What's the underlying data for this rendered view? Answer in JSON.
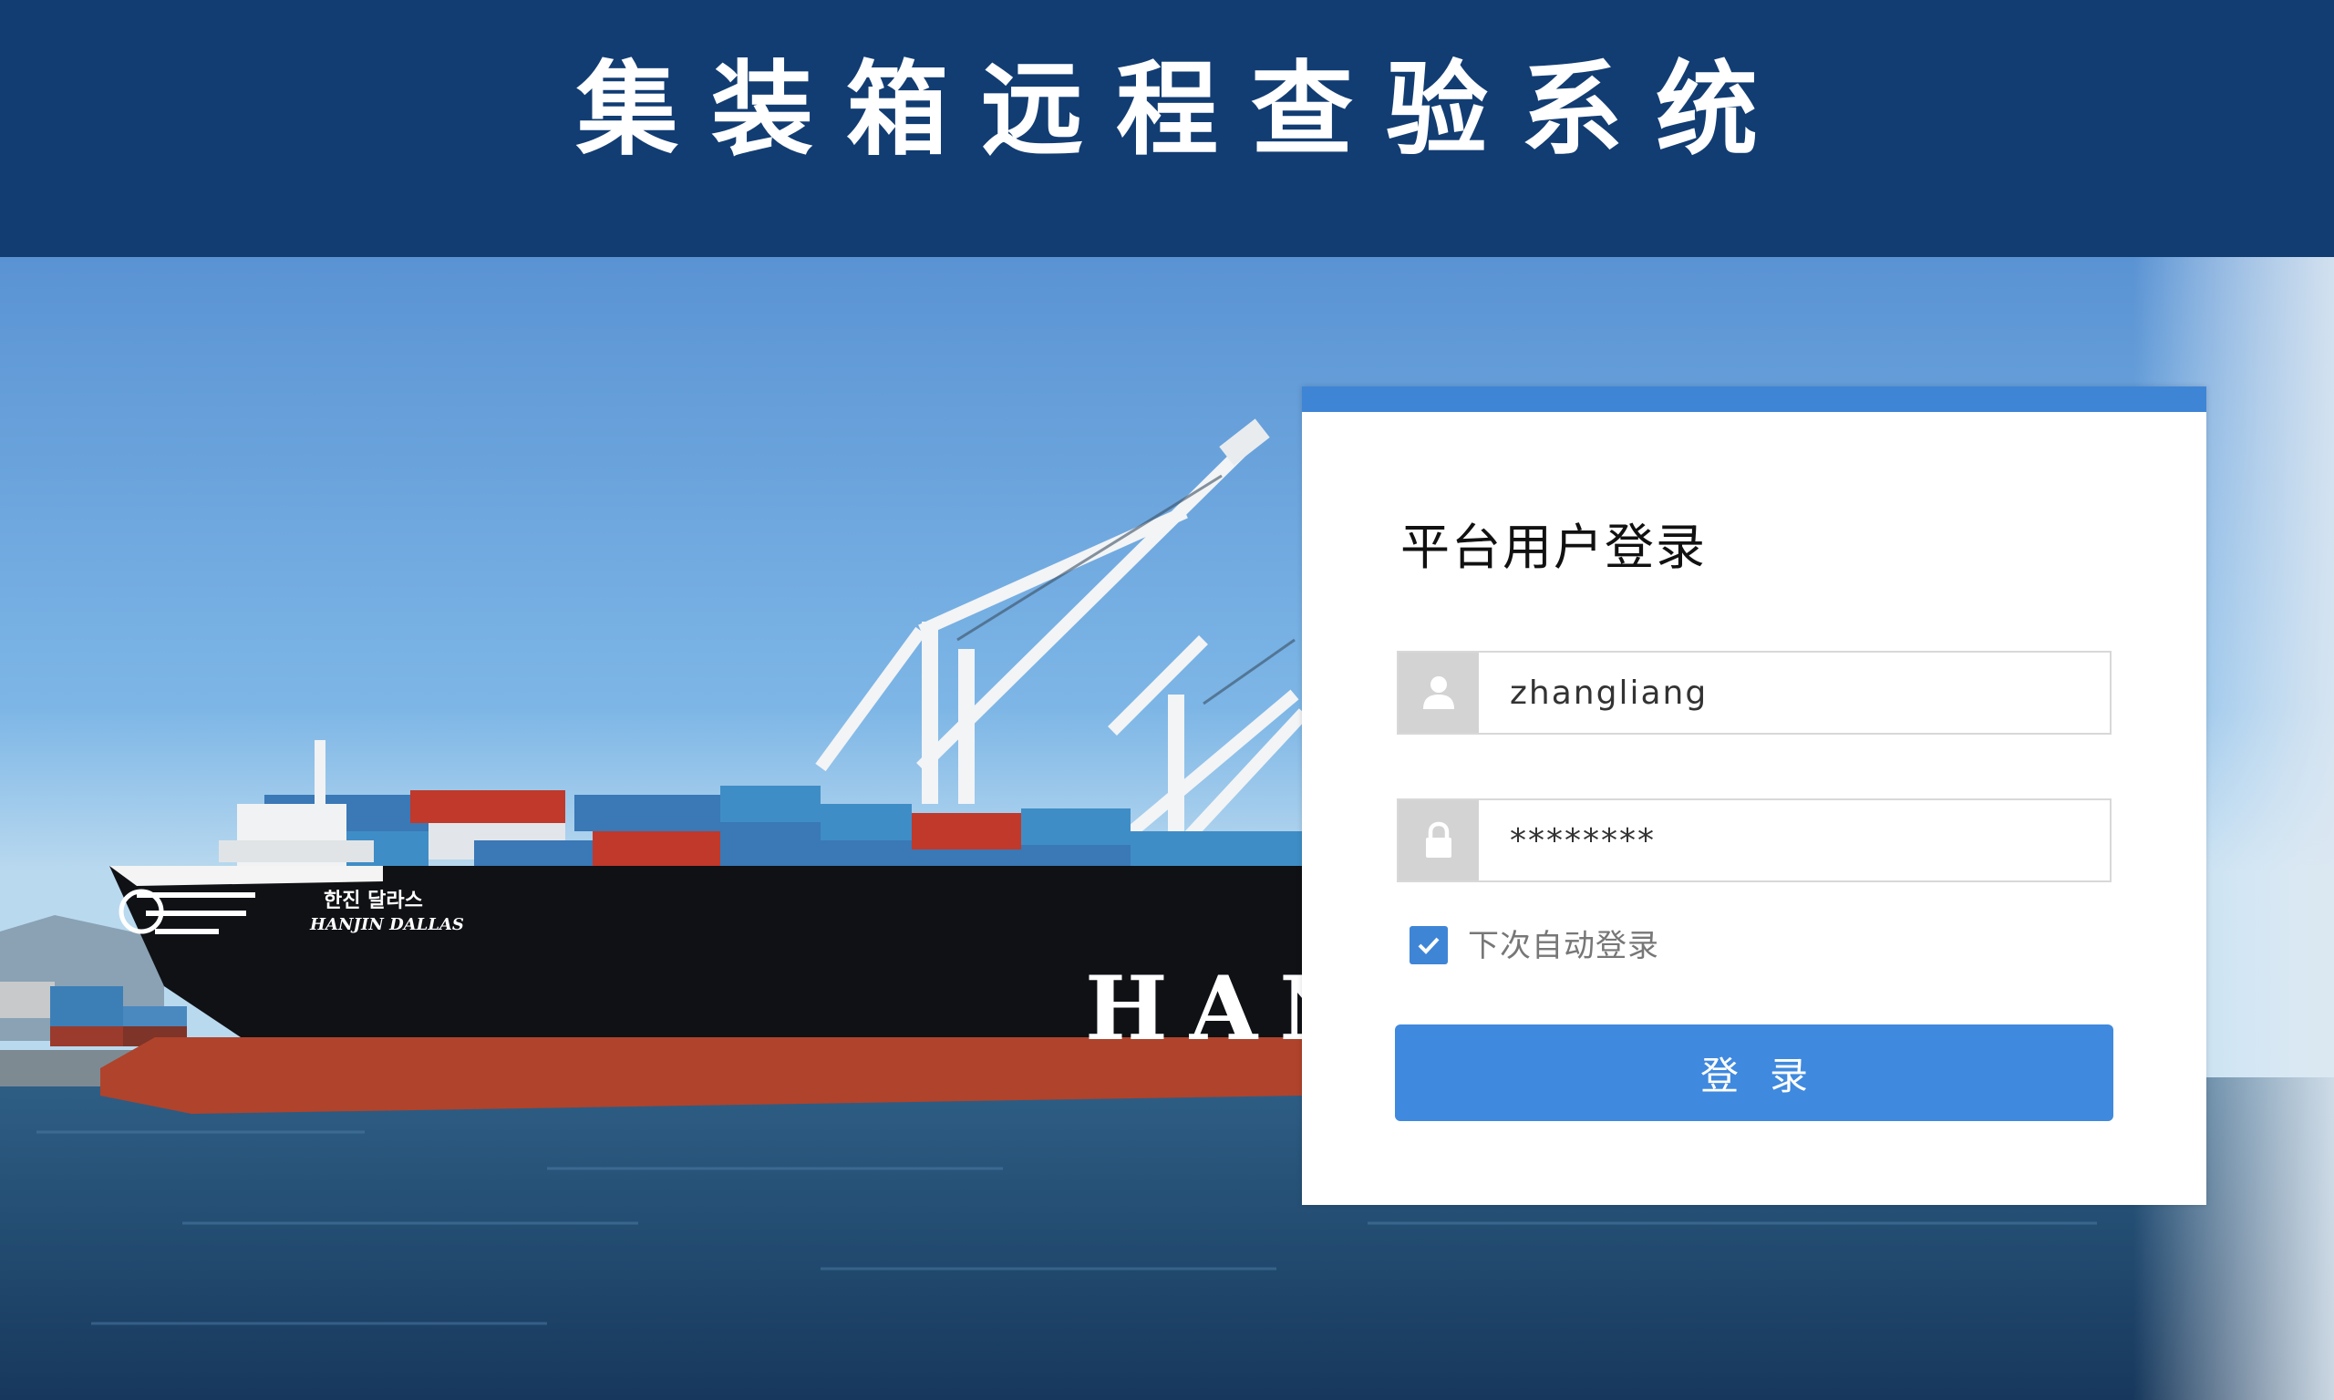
{
  "header": {
    "title": "集装箱远程查验系统"
  },
  "scene": {
    "ship_name_korean": "한진 달라스",
    "ship_name": "HANJIN DALLAS",
    "hull_lettering": "HAN"
  },
  "login": {
    "title": "平台用户登录",
    "username": {
      "icon": "user-icon",
      "value": "zhangliang"
    },
    "password": {
      "icon": "lock-icon",
      "value": "********"
    },
    "remember": {
      "label": "下次自动登录",
      "checked": true
    },
    "submit_label": "登录"
  },
  "colors": {
    "header_bg": "#123d73",
    "accent": "#3f85d6",
    "button": "#3f89de"
  }
}
